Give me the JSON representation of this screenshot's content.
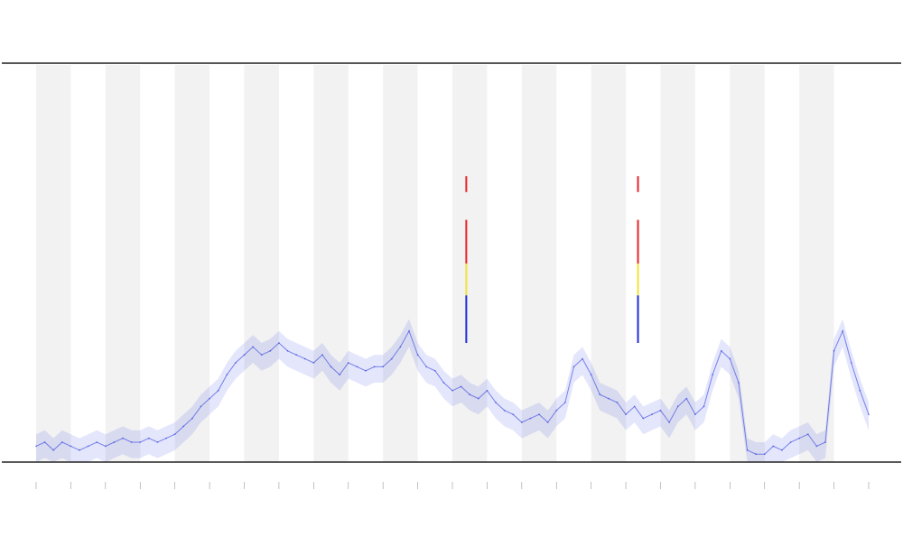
{
  "chart_data": {
    "type": "line",
    "title": "",
    "xlabel": "",
    "ylabel": "",
    "xlim": [
      0,
      24
    ],
    "ylim": [
      0,
      1
    ],
    "grid": false,
    "background_bands": "alternating",
    "colors": {
      "band": "#f2f2f2",
      "series_low": "#1f2fdc",
      "series_mid": "#f3e23a",
      "series_high": "#e8242a",
      "axis": "#222222",
      "top_rule": "#555555"
    },
    "x": [
      0,
      0.25,
      0.5,
      0.75,
      1,
      1.25,
      1.5,
      1.75,
      2,
      2.25,
      2.5,
      2.75,
      3,
      3.25,
      3.5,
      3.75,
      4,
      4.25,
      4.5,
      4.75,
      5,
      5.25,
      5.5,
      5.75,
      6,
      6.25,
      6.5,
      6.75,
      7,
      7.25,
      7.5,
      7.75,
      8,
      8.25,
      8.5,
      8.75,
      9,
      9.25,
      9.5,
      9.75,
      10,
      10.25,
      10.5,
      10.75,
      11,
      11.25,
      11.5,
      11.75,
      12,
      12.25,
      12.5,
      12.75,
      13,
      13.25,
      13.5,
      13.75,
      14,
      14.25,
      14.5,
      14.75,
      15,
      15.25,
      15.5,
      15.75,
      16,
      16.25,
      16.5,
      16.75,
      17,
      17.25,
      17.5,
      17.75,
      18,
      18.25,
      18.5,
      18.75,
      19,
      19.25,
      19.5,
      19.75,
      20,
      20.25,
      20.5,
      20.75,
      21,
      21.25,
      21.5,
      21.75,
      22,
      22.25,
      22.5,
      22.75,
      23,
      23.25,
      23.5,
      23.75,
      24
    ],
    "series": [
      {
        "values": [
          0.04,
          0.05,
          0.03,
          0.05,
          0.04,
          0.03,
          0.04,
          0.05,
          0.04,
          0.05,
          0.06,
          0.05,
          0.05,
          0.06,
          0.05,
          0.06,
          0.07,
          0.09,
          0.11,
          0.14,
          0.16,
          0.18,
          0.22,
          0.25,
          0.27,
          0.29,
          0.27,
          0.28,
          0.3,
          0.28,
          0.27,
          0.26,
          0.25,
          0.27,
          0.24,
          0.22,
          0.25,
          0.24,
          0.23,
          0.24,
          0.24,
          0.26,
          0.29,
          0.33,
          0.27,
          0.24,
          0.23,
          0.2,
          0.18,
          0.19,
          0.17,
          0.16,
          0.18,
          0.15,
          0.13,
          0.12,
          0.1,
          0.11,
          0.12,
          0.1,
          0.13,
          0.15,
          0.24,
          0.26,
          0.22,
          0.17,
          0.16,
          0.15,
          0.12,
          0.14,
          0.11,
          0.12,
          0.13,
          0.1,
          0.14,
          0.16,
          0.12,
          0.14,
          0.22,
          0.28,
          0.26,
          0.2,
          0.03,
          0.02,
          0.02,
          0.04,
          0.03,
          0.05,
          0.06,
          0.07,
          0.04,
          0.05,
          0.28,
          0.33,
          0.25,
          0.18,
          0.12,
          0.08,
          0.11
        ]
      }
    ],
    "spikes": [
      {
        "x": 12.4,
        "y_top": 0.72
      },
      {
        "x": 17.35,
        "y_top": 0.72
      }
    ]
  }
}
